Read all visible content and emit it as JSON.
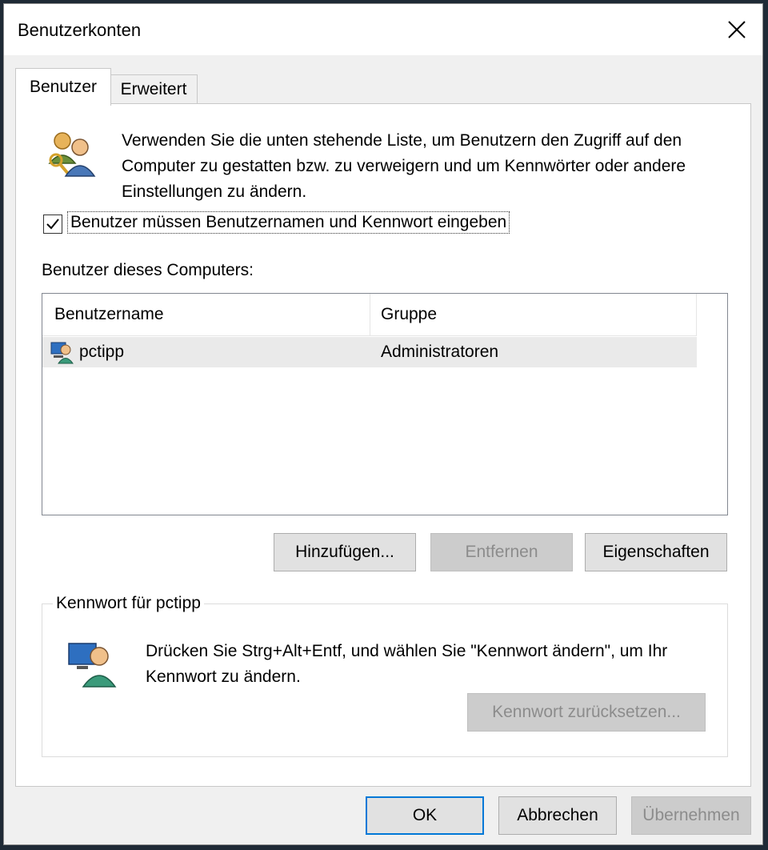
{
  "window": {
    "title": "Benutzerkonten"
  },
  "tabs": [
    {
      "label": "Benutzer",
      "active": true
    },
    {
      "label": "Erweitert",
      "active": false
    }
  ],
  "info_text": "Verwenden Sie die unten stehende Liste, um Benutzern den Zugriff auf den Computer zu gestatten bzw. zu verweigern und um Kennwörter oder andere Einstellungen zu ändern.",
  "require_login": {
    "label": "Benutzer müssen Benutzernamen und Kennwort eingeben",
    "checked": true
  },
  "user_list": {
    "label": "Benutzer dieses Computers:",
    "columns": [
      "Benutzername",
      "Gruppe"
    ],
    "rows": [
      {
        "user": "pctipp",
        "group": "Administratoren"
      }
    ]
  },
  "list_buttons": {
    "add": "Hinzufügen...",
    "remove": "Entfernen",
    "properties": "Eigenschaften"
  },
  "password_group": {
    "title": "Kennwort für pctipp",
    "text": "Drücken Sie Strg+Alt+Entf, und wählen Sie \"Kennwort ändern\", um Ihr Kennwort zu ändern.",
    "reset_button": "Kennwort zurücksetzen..."
  },
  "footer": {
    "ok": "OK",
    "cancel": "Abbrechen",
    "apply": "Übernehmen"
  },
  "colors": {
    "accent": "#0078d7",
    "panel": "#ffffff",
    "chrome": "#f0f0f0"
  },
  "icons": [
    "close-icon",
    "users-icon",
    "checkbox-check-icon",
    "user-computer-icon",
    "user-monitor-icon"
  ]
}
